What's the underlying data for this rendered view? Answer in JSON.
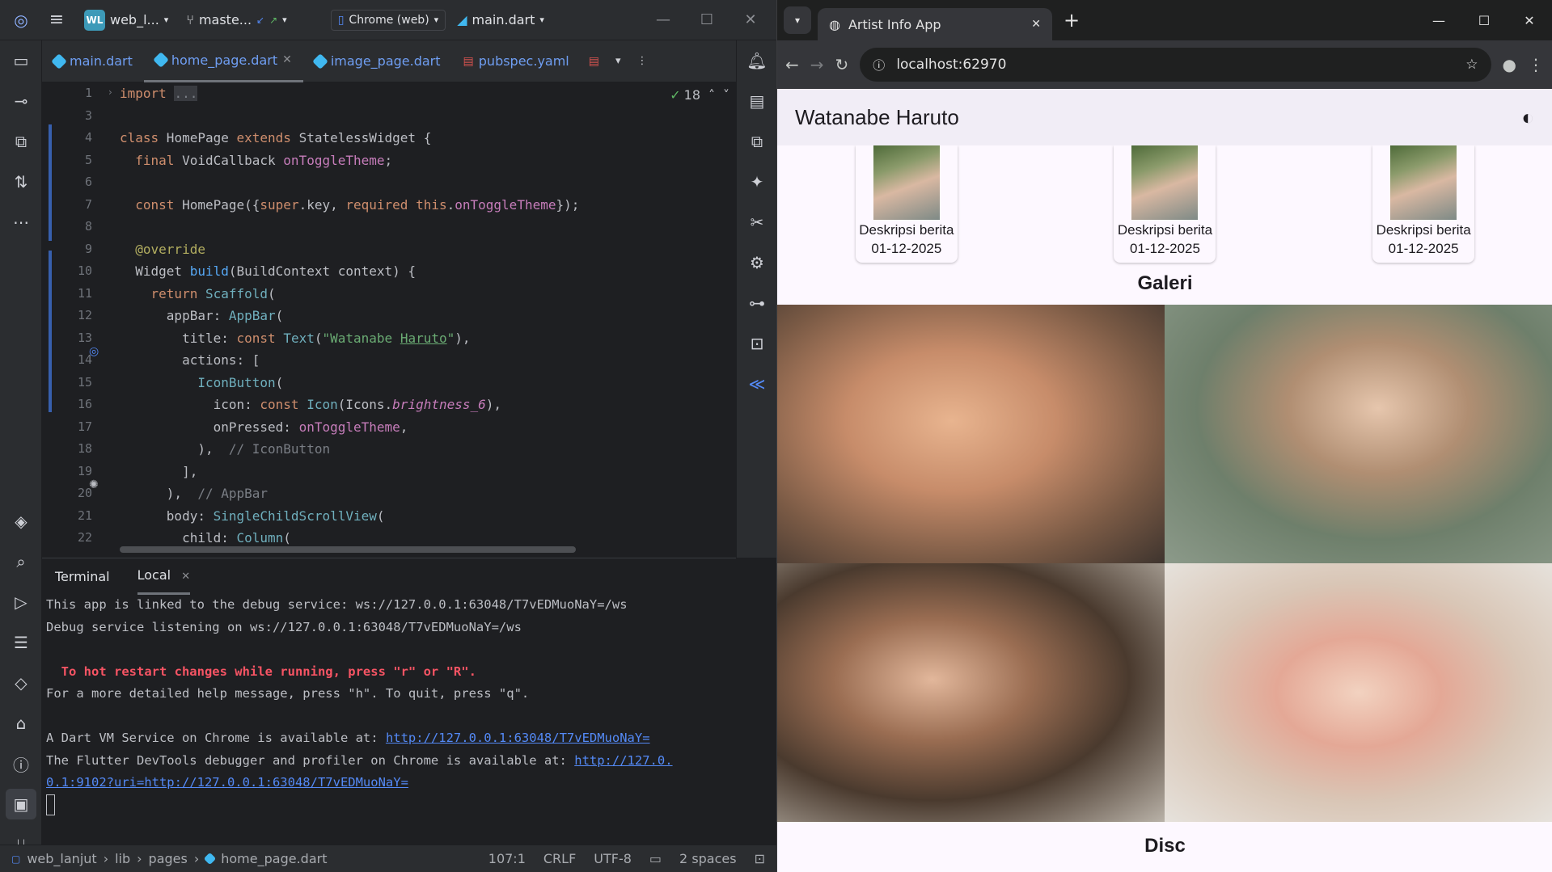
{
  "ide": {
    "project": "web_l...",
    "project_badge": "WL",
    "branch": "maste...",
    "run_config": "Chrome (web)",
    "run_file": "main.dart",
    "tabs": [
      {
        "label": "main.dart"
      },
      {
        "label": "home_page.dart"
      },
      {
        "label": "image_page.dart"
      },
      {
        "label": "pubspec.yaml"
      }
    ],
    "inspection_count": "18",
    "line_numbers": [
      "1",
      "3",
      "4",
      "5",
      "6",
      "7",
      "8",
      "9",
      "10",
      "11",
      "12",
      "13",
      "14",
      "15",
      "16",
      "17",
      "18",
      "19",
      "20",
      "21",
      "22"
    ],
    "terminal": {
      "tab_title": "Terminal",
      "tab_local": "Local",
      "lines": [
        "This app is linked to the debug service: ws://127.0.0.1:63048/T7vEDMuoNaY=/ws",
        "Debug service listening on ws://127.0.0.1:63048/T7vEDMuoNaY=/ws",
        "",
        "  To hot restart changes while running, press \"r\" or \"R\".",
        "For a more detailed help message, press \"h\". To quit, press \"q\".",
        "",
        "A Dart VM Service on Chrome is available at: ",
        "The Flutter DevTools debugger and profiler on Chrome is available at: "
      ],
      "vm_link": "http://127.0.0.1:63048/T7vEDMuoNaY=",
      "devtools_link_1": "http://127.0.",
      "devtools_link_2": "0.1:9102?uri=http://127.0.0.1:63048/T7vEDMuoNaY="
    },
    "status": {
      "project": "web_lanjut",
      "lib": "lib",
      "pages": "pages",
      "file": "home_page.dart",
      "position": "107:1",
      "line_sep": "CRLF",
      "encoding": "UTF-8",
      "indent": "2 spaces"
    }
  },
  "browser": {
    "tab_title": "Artist Info App",
    "url": "localhost:62970",
    "app_title": "Watanabe Haruto",
    "cards": [
      {
        "desc": "Deskripsi berita",
        "date": "01-12-2025"
      },
      {
        "desc": "Deskripsi berita",
        "date": "01-12-2025"
      },
      {
        "desc": "Deskripsi berita",
        "date": "01-12-2025"
      }
    ],
    "gallery_title": "Galeri",
    "disc_title": "Disc"
  }
}
